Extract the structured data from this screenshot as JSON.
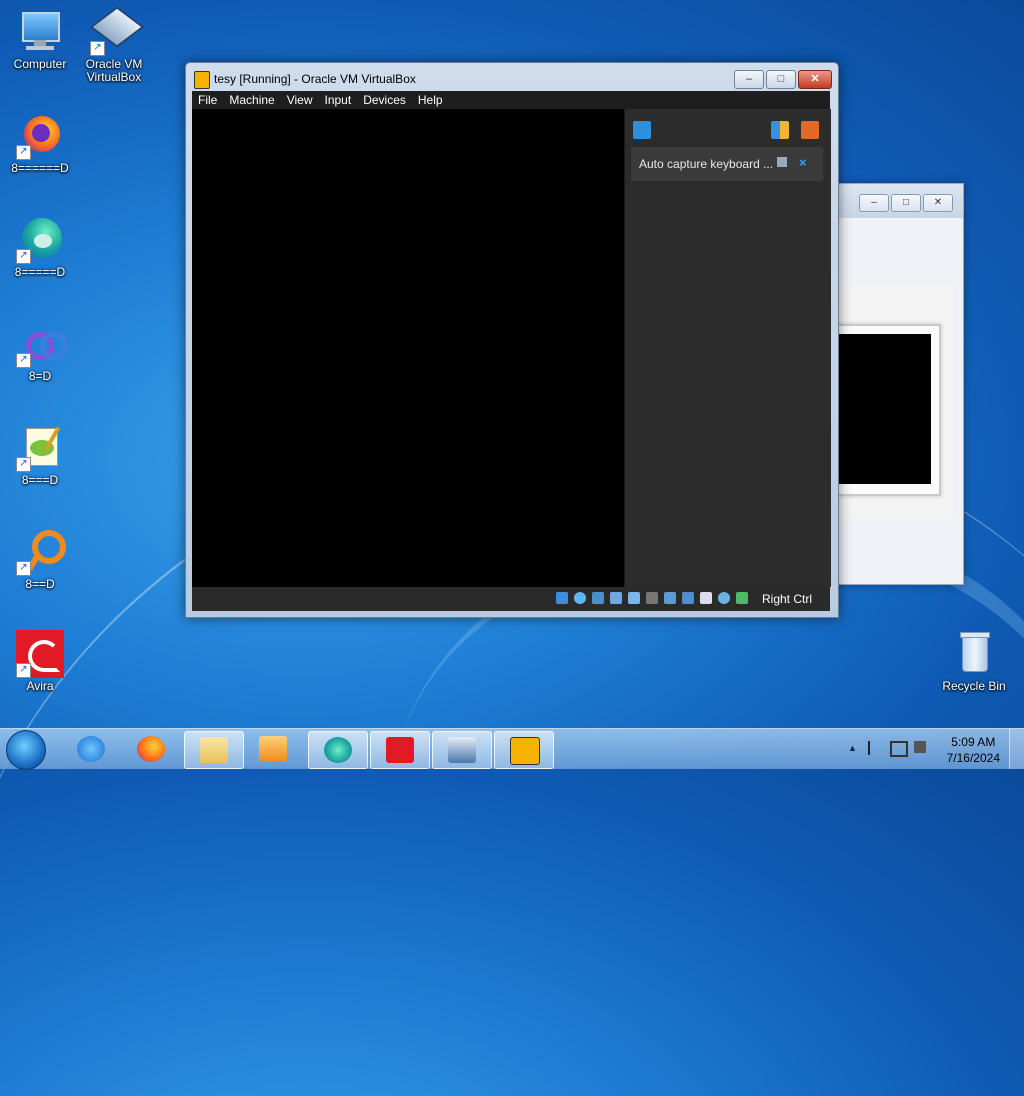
{
  "desktop": {
    "icons": [
      {
        "label": "Computer",
        "icon": "computer-icon"
      },
      {
        "label": "Oracle VM VirtualBox",
        "icon": "virtualbox-icon"
      },
      {
        "label": "8======D",
        "icon": "firefox-icon"
      },
      {
        "label": "8=====D",
        "icon": "edge-icon"
      },
      {
        "label": "8=D",
        "icon": "visual-studio-icon"
      },
      {
        "label": "8===D",
        "icon": "notepad-plus-plus-icon"
      },
      {
        "label": "8==D",
        "icon": "orange-ring-icon"
      },
      {
        "label": "Avira",
        "icon": "avira-icon"
      },
      {
        "label": "Recycle Bin",
        "icon": "recycle-bin-icon"
      }
    ]
  },
  "vbox_window": {
    "title": "tesy [Running] - Oracle VM VirtualBox",
    "menu": [
      "File",
      "Machine",
      "View",
      "Input",
      "Devices",
      "Help"
    ],
    "notification": {
      "text": "Auto capture keyboard ...",
      "close": "×"
    },
    "status": {
      "host_key": "Right Ctrl"
    },
    "min_label": "–",
    "max_label": "□",
    "close_label": "✕"
  },
  "taskbar": {
    "items": [
      "internet-explorer-icon",
      "firefox-icon",
      "file-explorer-icon",
      "media-player-icon",
      "edge-icon",
      "avira-icon",
      "virtualbox-icon",
      "vm-running-icon"
    ],
    "clock": {
      "time": "5:09 AM",
      "date": "7/16/2024"
    }
  },
  "colors": {
    "accent": "#1f7fd6",
    "menubar": "#1e1e1e",
    "panel": "#2c2c2c",
    "avira_red": "#e21a25"
  }
}
